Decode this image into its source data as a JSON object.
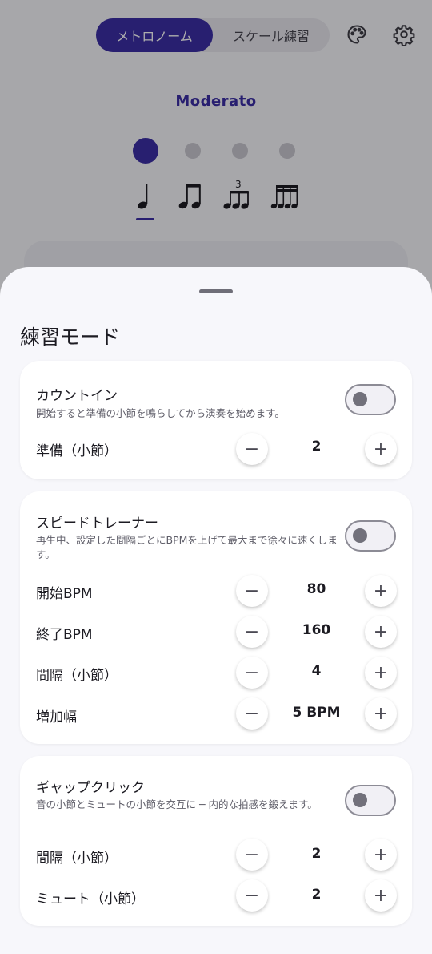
{
  "header": {
    "tabs": [
      {
        "label": "メトロノーム",
        "active": true
      },
      {
        "label": "スケール練習",
        "active": false
      }
    ],
    "icons": [
      "palette-icon",
      "settings-icon"
    ]
  },
  "metronome": {
    "tempo_name": "Moderato",
    "beats": 4,
    "active_beat": 1,
    "subdivisions": [
      "quarter-note-icon",
      "eighth-notes-icon",
      "triplet-icon",
      "sixteenth-notes-icon"
    ],
    "triplet_label": "3",
    "selected_subdivision": 0
  },
  "sheet": {
    "title": "練習モード",
    "count_in": {
      "title": "カウントイン",
      "description": "開始すると準備の小節を鳴らしてから演奏を始めます。",
      "enabled": false,
      "rows": [
        {
          "label": "準備（小節）",
          "value": "2"
        }
      ]
    },
    "speed_trainer": {
      "title": "スピードトレーナー",
      "description": "再生中、設定した間隔ごとにBPMを上げて最大まで徐々に速くします。",
      "enabled": false,
      "rows": [
        {
          "label": "開始BPM",
          "value": "80"
        },
        {
          "label": "終了BPM",
          "value": "160"
        },
        {
          "label": "間隔（小節）",
          "value": "4"
        },
        {
          "label": "増加幅",
          "value": "5 BPM"
        }
      ]
    },
    "gap_click": {
      "title": "ギャップクリック",
      "description": "音の小節とミュートの小節を交互に ─ 内的な拍感を鍛えます。",
      "enabled": false,
      "rows": [
        {
          "label": "間隔（小節）",
          "value": "2"
        },
        {
          "label": "ミュート（小節）",
          "value": "2"
        }
      ]
    },
    "minus_symbol": "−",
    "plus_symbol": "+"
  },
  "colors": {
    "accent": "#3b2ea6",
    "sheet_bg": "#f7f7fb",
    "card_bg": "#ffffff"
  }
}
